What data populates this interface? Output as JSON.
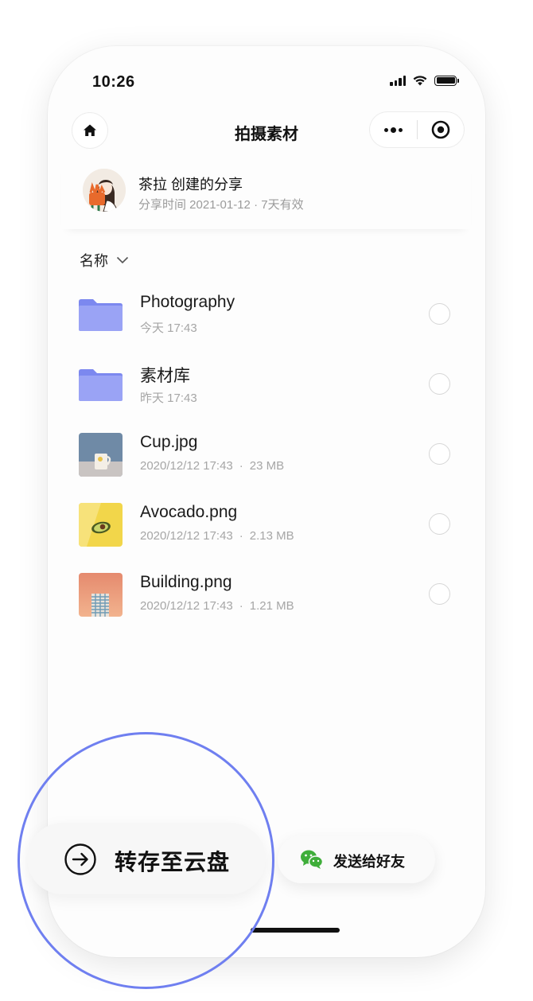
{
  "status_bar": {
    "time": "10:26"
  },
  "nav": {
    "title": "拍摄素材",
    "home_icon": "home-icon",
    "more_icon": "more-dots-icon",
    "close_icon": "target-close-icon"
  },
  "share": {
    "owner": "茶拉 创建的分享",
    "meta": "分享时间 2021-01-12 · 7天有效"
  },
  "sort": {
    "label": "名称"
  },
  "files": [
    {
      "name": "Photography",
      "meta": "今天 17:43",
      "size": "",
      "type": "folder"
    },
    {
      "name": "素材库",
      "meta": "昨天 17:43",
      "size": "",
      "type": "folder"
    },
    {
      "name": "Cup.jpg",
      "meta": "2020/12/12 17:43",
      "size": "23 MB",
      "type": "image-cup"
    },
    {
      "name": "Avocado.png",
      "meta": "2020/12/12 17:43",
      "size": "2.13 MB",
      "type": "image-avocado"
    },
    {
      "name": "Building.png",
      "meta": "2020/12/12 17:43",
      "size": "1.21 MB",
      "type": "image-building"
    }
  ],
  "actions": {
    "save": "转存至云盘",
    "send": "发送给好友"
  },
  "colors": {
    "accent_ring": "#6f7ff0",
    "folder": "#8b96f2",
    "wechat_green": "#3fae3a"
  }
}
